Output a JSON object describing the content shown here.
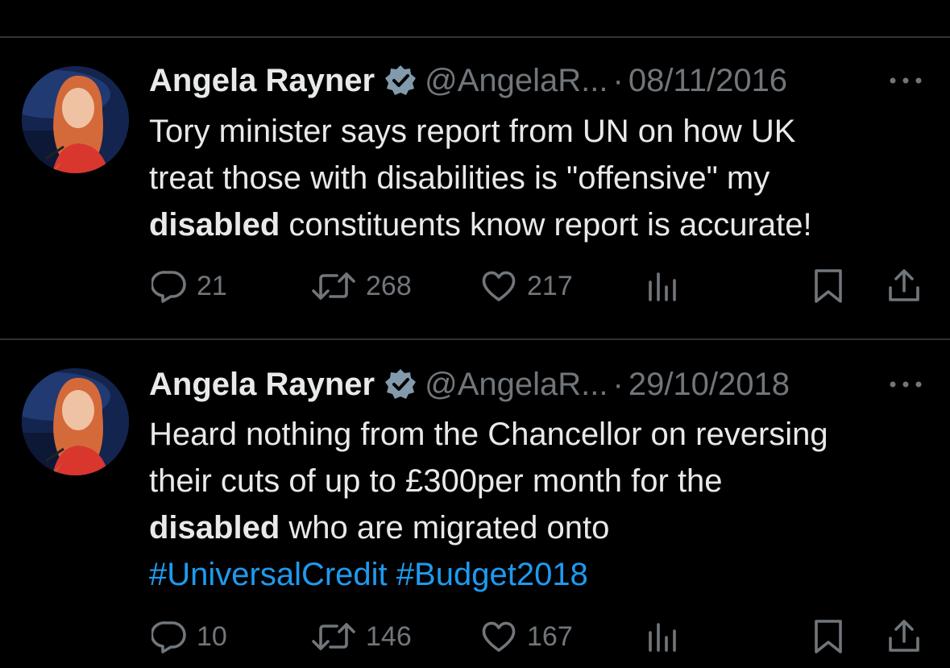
{
  "tweets": [
    {
      "name": "Angela Rayner",
      "handle": "@AngelaR...",
      "separator": "·",
      "date": "08/11/2016",
      "text_lines": [
        [
          "Tory minister says report from UN on how UK"
        ],
        [
          "treat those with disabilities is \"offensive\" my"
        ],
        [
          "disabled",
          " constituents know  report is accurate!"
        ]
      ],
      "replies": "21",
      "retweets": "268",
      "likes": "217"
    },
    {
      "name": "Angela Rayner",
      "handle": "@AngelaR...",
      "separator": "·",
      "date": "29/10/2018",
      "text_lines": [
        [
          "Heard nothing from the Chancellor on reversing"
        ],
        [
          "their cuts of up to £300per month for the"
        ],
        [
          "disabled",
          " who are migrated onto"
        ],
        [
          "#UniversalCredit",
          " ",
          "#Budget2018"
        ]
      ],
      "replies": "10",
      "retweets": "146",
      "likes": "167"
    }
  ],
  "colors": {
    "background": "#000000",
    "text": "#e7e9ea",
    "muted": "#71767b",
    "link": "#1d9bf0",
    "verified": "#829aab",
    "divider": "#2f3336"
  },
  "icons": [
    "reply-icon",
    "retweet-icon",
    "like-icon",
    "views-icon",
    "bookmark-icon",
    "share-icon",
    "more-icon",
    "verified-icon"
  ]
}
